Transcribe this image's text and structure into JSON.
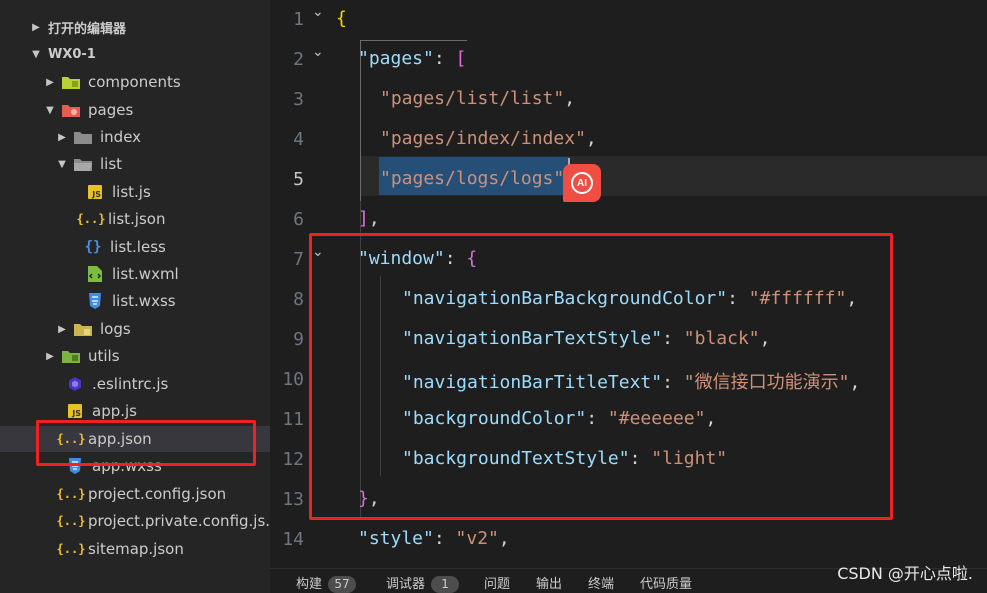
{
  "sidebar": {
    "open_editors_label": "打开的编辑器",
    "project_label": "WX0-1",
    "items": [
      {
        "label": "components"
      },
      {
        "label": "pages"
      },
      {
        "label": "index"
      },
      {
        "label": "list"
      },
      {
        "label": "list.js"
      },
      {
        "label": "list.json"
      },
      {
        "label": "list.less"
      },
      {
        "label": "list.wxml"
      },
      {
        "label": "list.wxss"
      },
      {
        "label": "logs"
      },
      {
        "label": "utils"
      },
      {
        "label": ".eslintrc.js"
      },
      {
        "label": "app.js"
      },
      {
        "label": "app.json"
      },
      {
        "label": "app.wxss"
      },
      {
        "label": "project.config.json"
      },
      {
        "label": "project.private.config.js..."
      },
      {
        "label": "sitemap.json"
      }
    ]
  },
  "editor": {
    "line_numbers": [
      "1",
      "2",
      "3",
      "4",
      "5",
      "6",
      "7",
      "8",
      "9",
      "10",
      "11",
      "12",
      "13",
      "14"
    ],
    "code": {
      "l1_brace": "{",
      "l2_key": "\"pages\"",
      "l2_punc": ": ",
      "l2_bracket": "[",
      "l3_str": "\"pages/list/list\"",
      "l3_punc": ",",
      "l4_str": "\"pages/index/index\"",
      "l4_punc": ",",
      "l5_str": "\"pages/logs/logs\"",
      "l6_bracket": "]",
      "l6_punc": ",",
      "l7_key": "\"window\"",
      "l7_punc": ": ",
      "l7_brace": "{",
      "l8_key": "\"navigationBarBackgroundColor\"",
      "l8_punc": ": ",
      "l8_str": "\"#ffffff\"",
      "l8_comma": ",",
      "l9_key": "\"navigationBarTextStyle\"",
      "l9_punc": ": ",
      "l9_str": "\"black\"",
      "l9_comma": ",",
      "l10_key": "\"navigationBarTitleText\"",
      "l10_punc": ": ",
      "l10_str": "\"微信接口功能演示\"",
      "l10_comma": ",",
      "l11_key": "\"backgroundColor\"",
      "l11_punc": ": ",
      "l11_str": "\"#eeeeee\"",
      "l11_comma": ",",
      "l12_key": "\"backgroundTextStyle\"",
      "l12_punc": ": ",
      "l12_str": "\"light\"",
      "l13_brace": "}",
      "l13_punc": ",",
      "l14_key": "\"style\"",
      "l14_punc": ": ",
      "l14_str": "\"v2\"",
      "l14_comma": ","
    },
    "ai_badge": "AI"
  },
  "panel": {
    "tabs": [
      {
        "label": "构建",
        "count": "57"
      },
      {
        "label": "调试器",
        "count": "1"
      },
      {
        "label": "问题"
      },
      {
        "label": "输出"
      },
      {
        "label": "终端"
      },
      {
        "label": "代码质量"
      }
    ]
  },
  "watermark": "CSDN @开心点啦.",
  "colors": {
    "annotation_red": "#ee2222",
    "json_key": "#9cdcfe",
    "json_string": "#ce9178",
    "ai_badge_bg": "#f04e42"
  }
}
